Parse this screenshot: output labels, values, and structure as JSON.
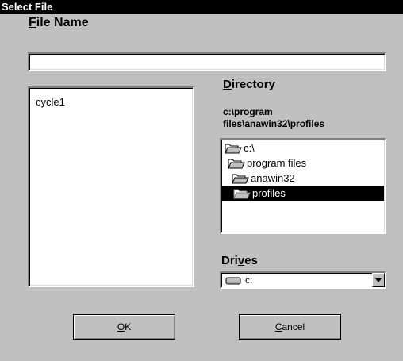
{
  "window": {
    "title": "Select File"
  },
  "file_name": {
    "label_mnemonic": "F",
    "label_rest": "ile Name",
    "value": ""
  },
  "files": {
    "items": [
      "cycle1"
    ]
  },
  "directory": {
    "label_mnemonic": "D",
    "label_rest": "irectory",
    "current_path_line1": "c:\\program",
    "current_path_line2": "files\\anawin32\\profiles",
    "tree": [
      {
        "label": "c:\\",
        "icon": "open-folder-icon"
      },
      {
        "label": "program files",
        "icon": "open-folder-icon"
      },
      {
        "label": "anawin32",
        "icon": "open-folder-icon"
      },
      {
        "label": "profiles",
        "icon": "open-folder-icon",
        "selected": true
      }
    ]
  },
  "drives": {
    "label_pre": "Dri",
    "label_mnemonic": "v",
    "label_post": "es",
    "selected": "c:",
    "icon": "drive-icon"
  },
  "buttons": {
    "ok_mnemonic": "O",
    "ok_rest": "K",
    "cancel_mnemonic": "C",
    "cancel_rest": "ancel"
  }
}
